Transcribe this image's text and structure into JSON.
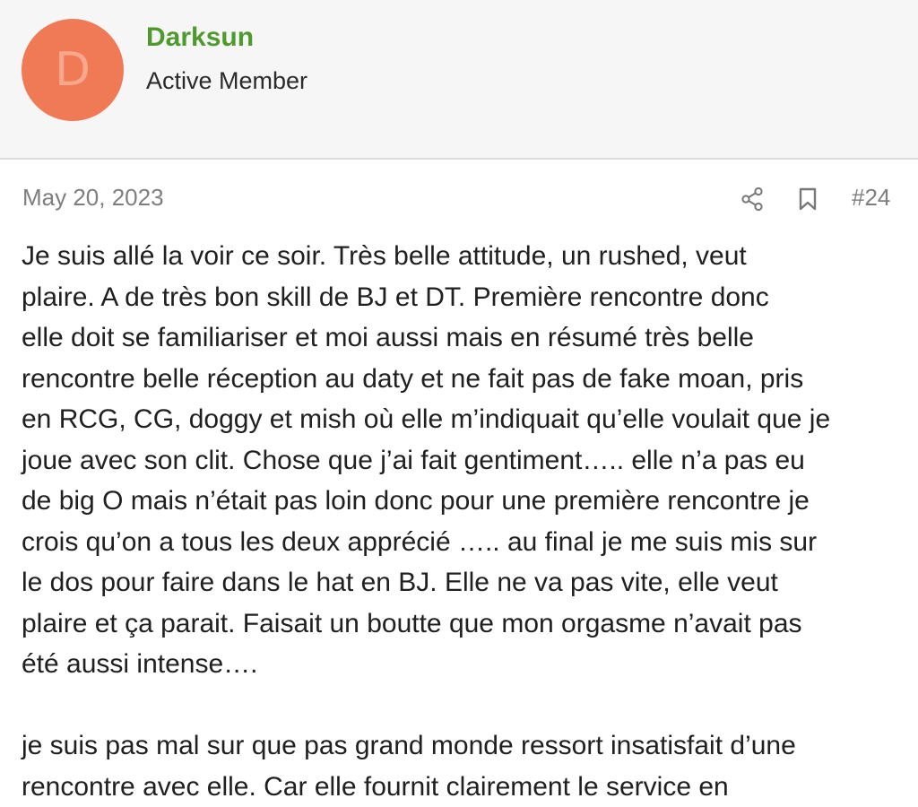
{
  "user": {
    "avatar_letter": "D",
    "name": "Darksun",
    "title": "Active Member",
    "avatar_color": "#f07a55",
    "name_color": "#4f9a2f"
  },
  "post": {
    "date": "May 20, 2023",
    "number": "#24",
    "share_icon": "share-icon",
    "bookmark_icon": "bookmark-icon",
    "paragraphs": [
      "Je suis allé la voir ce soir. Très belle attitude, un rushed, veut\nplaire. A de très bon skill de BJ et DT. Première rencontre donc\nelle doit se familiariser et moi aussi mais en résumé très belle\nrencontre belle réception au daty et ne fait pas de fake moan, pris\nen RCG, CG, doggy et mish où elle m’indiquait qu’elle voulait que je\njoue avec son clit. Chose que j’ai fait gentiment….. elle n’a pas eu\nde big O mais n’était pas loin donc pour une première rencontre je\ncrois qu’on a tous les deux apprécié ….. au final je me suis mis sur\nle dos pour faire dans le hat en BJ. Elle ne va pas vite, elle veut\nplaire et ça parait. Faisait un boutte que mon orgasme n’avait pas\nété aussi intense….",
      "je suis pas mal sur que pas grand monde ressort insatisfait d’une\nrencontre avec elle. Car elle fournit clairement le service en"
    ]
  }
}
